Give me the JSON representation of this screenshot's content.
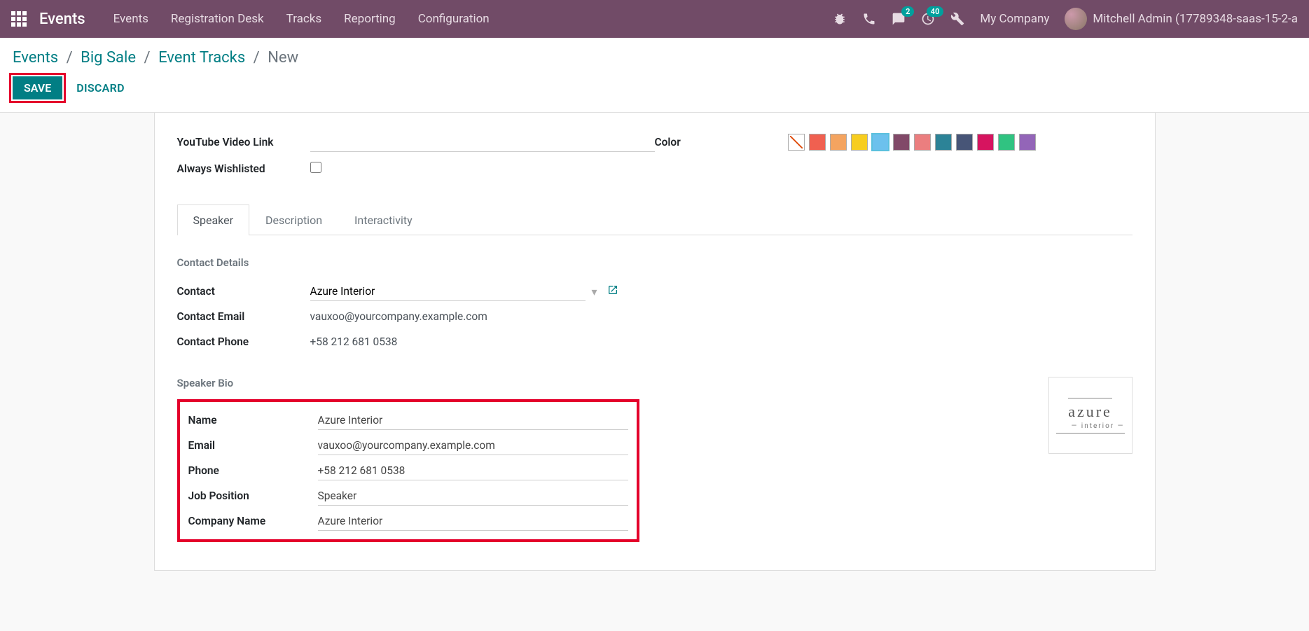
{
  "topnav": {
    "app_title": "Events",
    "links": [
      "Events",
      "Registration Desk",
      "Tracks",
      "Reporting",
      "Configuration"
    ],
    "chat_badge": "2",
    "activity_badge": "40",
    "company": "My Company",
    "user": "Mitchell Admin (17789348-saas-15-2-a"
  },
  "breadcrumb": {
    "items": [
      "Events",
      "Big Sale",
      "Event Tracks"
    ],
    "current": "New"
  },
  "actions": {
    "save": "SAVE",
    "discard": "DISCARD"
  },
  "form": {
    "youtube_label": "YouTube Video Link",
    "wishlisted_label": "Always Wishlisted",
    "color_label": "Color"
  },
  "colors": [
    "#F06050",
    "#F4A460",
    "#F7CD1F",
    "#6CC1ED",
    "#814968",
    "#EB7E7F",
    "#2C8397",
    "#475577",
    "#D6145F",
    "#30C381",
    "#9365B8"
  ],
  "selected_color_index": 3,
  "tabs": [
    "Speaker",
    "Description",
    "Interactivity"
  ],
  "active_tab": 0,
  "contact": {
    "section": "Contact Details",
    "contact_label": "Contact",
    "contact_val": "Azure Interior",
    "email_label": "Contact Email",
    "email_val": "vauxoo@yourcompany.example.com",
    "phone_label": "Contact Phone",
    "phone_val": "+58 212 681 0538"
  },
  "bio": {
    "section": "Speaker Bio",
    "name_label": "Name",
    "name_val": "Azure Interior",
    "email_label": "Email",
    "email_val": "vauxoo@yourcompany.example.com",
    "phone_label": "Phone",
    "phone_val": "+58 212 681 0538",
    "job_label": "Job Position",
    "job_val": "Speaker",
    "company_label": "Company Name",
    "company_val": "Azure Interior"
  },
  "logo": {
    "name": "azure",
    "sub": "— interior —"
  }
}
